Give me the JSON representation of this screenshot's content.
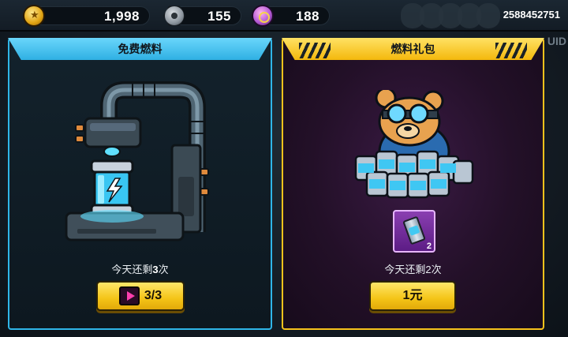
{
  "top_bar": {
    "coins": "1,998",
    "nuts": "155",
    "gems": "188",
    "uid_number": "2588452751",
    "uid_label": "UID"
  },
  "free_fuel": {
    "title": "免费燃料",
    "remaining_prefix": "今天还剩",
    "remaining_count": "3",
    "remaining_suffix": "次",
    "button_label": "3/3"
  },
  "fuel_pack": {
    "title": "燃料礼包",
    "item_count": "2",
    "remaining_text": "今天还剩2次",
    "price_label": "1元"
  },
  "colors": {
    "left_accent": "#2fb6e8",
    "right_accent": "#f6c21c",
    "button": "#f4c417"
  }
}
